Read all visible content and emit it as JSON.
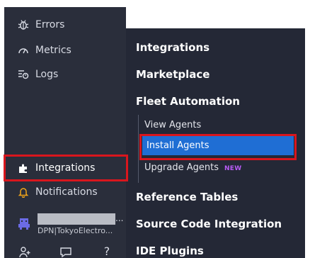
{
  "sidebar": {
    "items": [
      {
        "label": "Errors",
        "icon": "bug-icon"
      },
      {
        "label": "Metrics",
        "icon": "gauge-icon"
      },
      {
        "label": "Logs",
        "icon": "logs-icon"
      },
      {
        "label": "Integrations",
        "icon": "puzzle-icon"
      },
      {
        "label": "Notifications",
        "icon": "bell-icon"
      }
    ],
    "user": {
      "name_ellipsis": "...",
      "org": "DPN|TokyoElectro..."
    },
    "bottom_icons": [
      "invite-user-icon",
      "chat-icon",
      "help-icon"
    ],
    "bottom_label_help": "?"
  },
  "flyout": {
    "sections": {
      "integrations": "Integrations",
      "marketplace": "Marketplace",
      "fleet": "Fleet Automation",
      "reference": "Reference Tables",
      "source": "Source Code Integration",
      "ide": "IDE Plugins"
    },
    "fleet_items": {
      "view": "View Agents",
      "install": "Install Agents",
      "upgrade": "Upgrade Agents",
      "upgrade_badge": "NEW"
    }
  },
  "colors": {
    "sidebar_bg": "#2a2e3b",
    "flyout_bg": "#242836",
    "active_item": "#1f6ed4",
    "highlight_box": "#d9161d",
    "badge_new": "#b85cf5"
  }
}
